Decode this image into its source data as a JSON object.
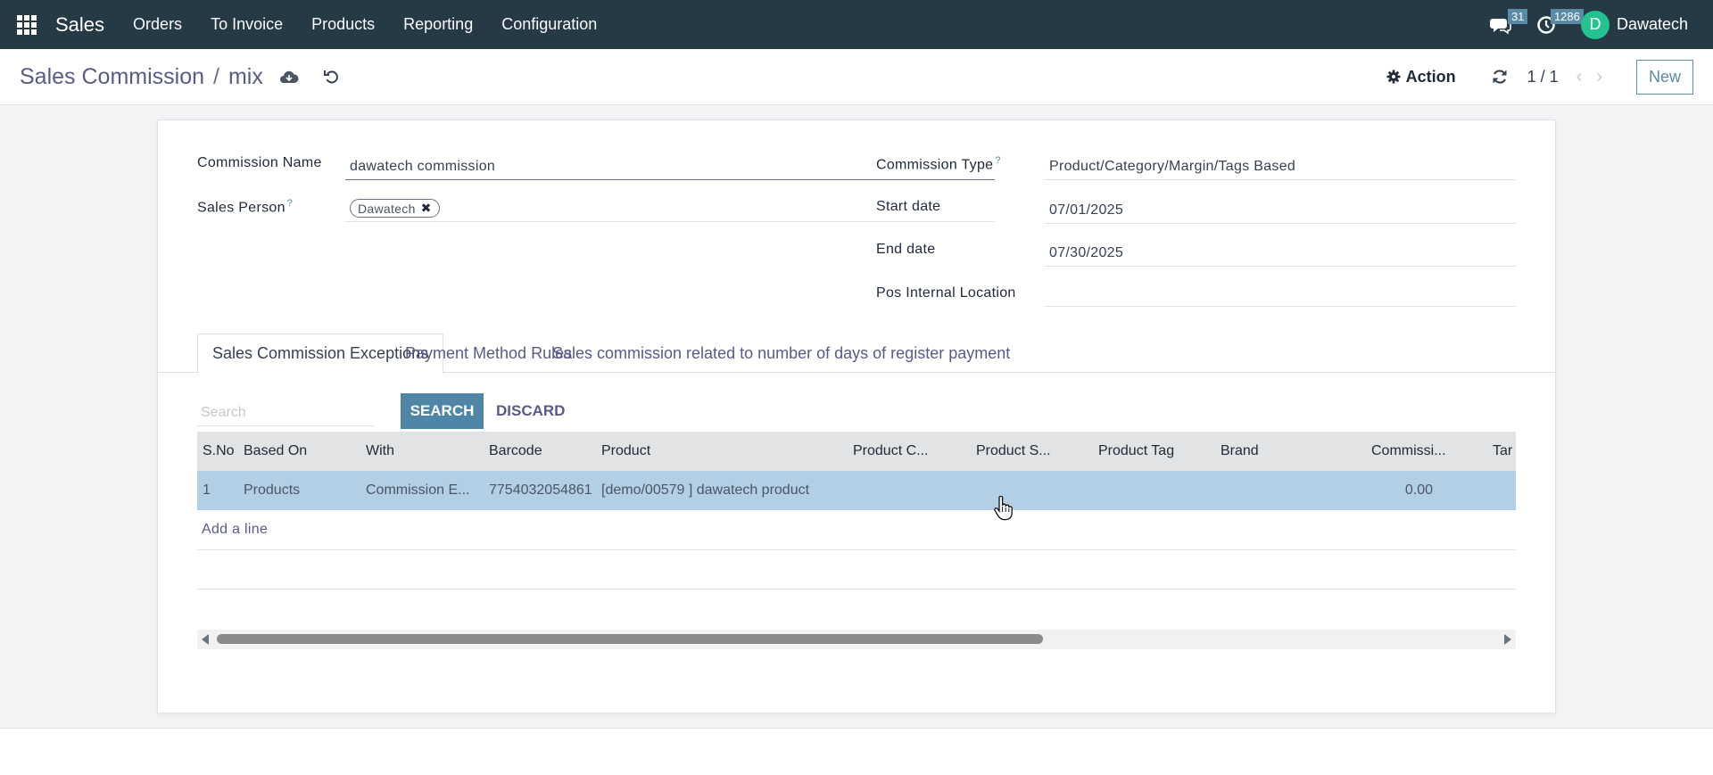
{
  "navbar": {
    "app_name": "Sales",
    "menu": [
      "Orders",
      "To Invoice",
      "Products",
      "Reporting",
      "Configuration"
    ],
    "messages_count": "31",
    "activities_count": "1286",
    "user_initial": "D",
    "user_name": "Dawatech"
  },
  "control_panel": {
    "breadcrumb_parent": "Sales Commission",
    "breadcrumb_separator": "/",
    "breadcrumb_current": "mix",
    "action_label": "Action",
    "pager": "1 / 1",
    "new_label": "New"
  },
  "form": {
    "commission_name_label": "Commission Name",
    "commission_name_value": "dawatech commission",
    "sales_person_label": "Sales Person",
    "sales_person_tag": "Dawatech",
    "commission_type_label": "Commission Type",
    "commission_type_value": "Product/Category/Margin/Tags Based",
    "start_date_label": "Start date",
    "start_date_value": "07/01/2025",
    "end_date_label": "End date",
    "end_date_value": "07/30/2025",
    "pos_location_label": "Pos Internal Location",
    "pos_location_value": "",
    "help_mark": "?"
  },
  "tabs": [
    "Sales Commission Exceptions",
    "Payment Method Rules",
    "Sales commission related to number of days of register payment"
  ],
  "list": {
    "search_placeholder": "Search",
    "search_label": "SEARCH",
    "discard_label": "DISCARD",
    "columns": [
      "S.No",
      "Based On",
      "With",
      "Barcode",
      "Product",
      "Product C...",
      "Product S...",
      "Product Tag",
      "Brand",
      "Commissi...",
      "Tar"
    ],
    "rows": [
      {
        "sno": "1",
        "based_on": "Products",
        "with": "Commission E...",
        "barcode": "7754032054861",
        "product": "[demo/00579 ] dawatech product",
        "product_category": "",
        "product_s": "",
        "product_tag": "",
        "brand": "",
        "commission": "0.00"
      }
    ],
    "add_line_label": "Add a line"
  },
  "colors": {
    "navbar_bg": "#263a46",
    "accent": "#4f86a8",
    "link": "#5a5a8a",
    "selected_row": "#b3cfe6",
    "avatar": "#22c38e"
  }
}
